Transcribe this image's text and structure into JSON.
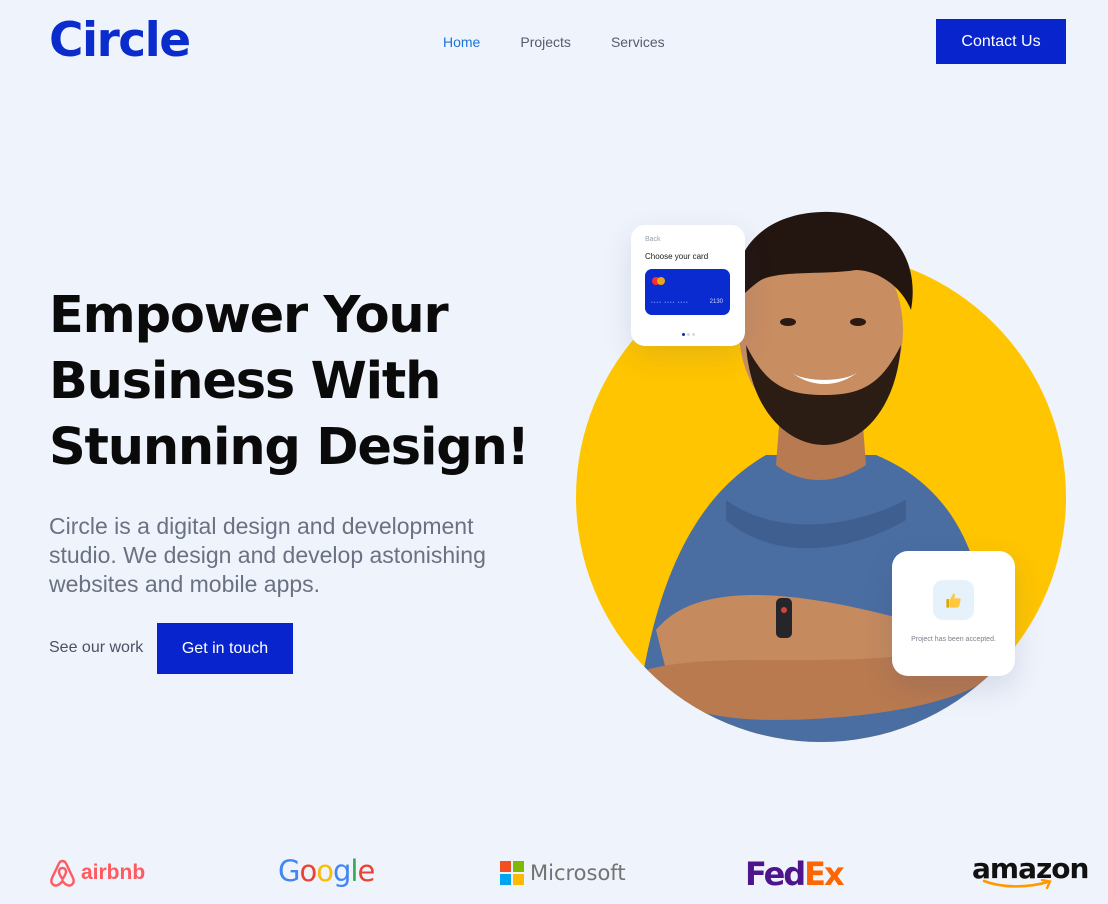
{
  "header": {
    "logo": "Circle",
    "nav": [
      {
        "label": "Home",
        "active": true
      },
      {
        "label": "Projects",
        "active": false
      },
      {
        "label": "Services",
        "active": false
      }
    ],
    "contact_label": "Contact Us"
  },
  "hero": {
    "title_lines": [
      "Empower Your",
      "Business With",
      "Stunning Design!"
    ],
    "subtitle_lines": [
      "Circle is a digital design and development",
      "studio. We design and develop astonishing",
      "websites and mobile apps."
    ],
    "secondary_link": "See our work",
    "cta_label": "Get in touch"
  },
  "card_widget": {
    "back": "Back",
    "title": "Choose your card",
    "card_masked": "•••• •••• ••••",
    "card_number": "2130"
  },
  "accept_widget": {
    "icon": "thumbs-up-icon",
    "text": "Project has been accepted."
  },
  "client_logos": {
    "airbnb": "airbnb",
    "google": "Google",
    "microsoft": "Microsoft",
    "fedex_fed": "Fed",
    "fedex_ex": "Ex",
    "amazon": "amazon"
  },
  "colors": {
    "brand_blue": "#0825cd",
    "nav_active": "#1c74d8",
    "accent_yellow": "#ffc500",
    "background": "#eff3fb"
  }
}
